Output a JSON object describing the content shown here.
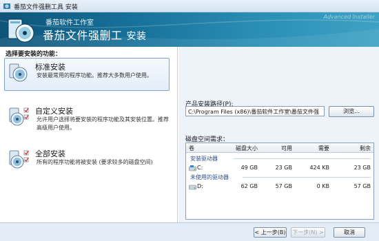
{
  "window": {
    "title": "番茄文件强删工具 安装"
  },
  "banner": {
    "company": "番茄软件工作室",
    "product": "番茄文件强删工",
    "install_word": "安装",
    "watermark": "Advanced Installer"
  },
  "features": {
    "heading": "选择要安装的功能：",
    "options": [
      {
        "title": "标准安装",
        "description": "安装最常用的程序功能。推荐大多数用户使用。",
        "selected": true
      },
      {
        "title": "自定义安装",
        "description": "允许用户选择将要安装的程序功能及其安装位置。推荐高级用户使用。",
        "selected": false
      },
      {
        "title": "全部安装",
        "description": "所有的程序功能将被安装 (要求较多的磁盘空间)",
        "selected": false
      }
    ]
  },
  "install_path": {
    "label": "产品安装路径(P):",
    "value": "C:\\Program Files (x86)\\番茄软件工作室\\番茄文件强",
    "browse_label": "浏览..."
  },
  "disk_space": {
    "label": "磁盘空间需求：",
    "columns": [
      "卷",
      "磁盘大小",
      "可用",
      "需要",
      "剩余"
    ],
    "groups": [
      {
        "name": "安装驱动器",
        "drives": [
          {
            "name": "C:",
            "size": "49 GB",
            "available": "23 GB",
            "required": "424 KB",
            "remaining": "23 GB"
          }
        ]
      },
      {
        "name": "未使用的驱动器",
        "drives": [
          {
            "name": "D:",
            "size": "62 GB",
            "available": "57 GB",
            "required": "0 KB",
            "remaining": "57 GB"
          }
        ]
      }
    ]
  },
  "footer": {
    "back_label": "< 上一步(B)",
    "next_label": "下一步(N) >",
    "cancel_label": "取消"
  },
  "colors": {
    "banner_dark": "#0d5478",
    "banner_light": "#3fa2c4",
    "selection_border": "#7da2ce",
    "right_panel_bg": "#eef3f9"
  }
}
